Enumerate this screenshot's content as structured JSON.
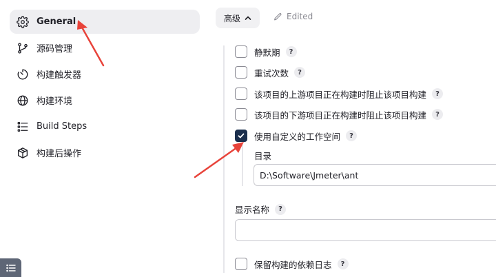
{
  "sidebar": {
    "items": [
      {
        "label": "General",
        "icon": "gear-icon",
        "active": true
      },
      {
        "label": "源码管理",
        "icon": "branch-icon"
      },
      {
        "label": "构建触发器",
        "icon": "timer-icon"
      },
      {
        "label": "构建环境",
        "icon": "globe-icon"
      },
      {
        "label": "Build Steps",
        "icon": "list-icon"
      },
      {
        "label": "构建后操作",
        "icon": "package-icon"
      }
    ]
  },
  "header": {
    "advanced_label": "高级",
    "edited_label": "Edited"
  },
  "options": [
    {
      "label": "静默期",
      "checked": false
    },
    {
      "label": "重试次数",
      "checked": false
    },
    {
      "label": "该项目的上游项目正在构建时阻止该项目构建",
      "checked": false
    },
    {
      "label": "该项目的下游项目正在构建时阻止该项目构建",
      "checked": false
    },
    {
      "label": "使用自定义的工作空间",
      "checked": true
    }
  ],
  "directory": {
    "label": "目录",
    "value": "D:\\Software\\Jmeter\\ant"
  },
  "display_name": {
    "label": "显示名称",
    "value": ""
  },
  "keep_log": {
    "label": "保留构建的依赖日志",
    "checked": false
  },
  "help_glyph": "?",
  "colors": {
    "accent": "#1b2f4d",
    "annotation_arrow": "#e8433a",
    "active_bg": "#eeeef1"
  }
}
